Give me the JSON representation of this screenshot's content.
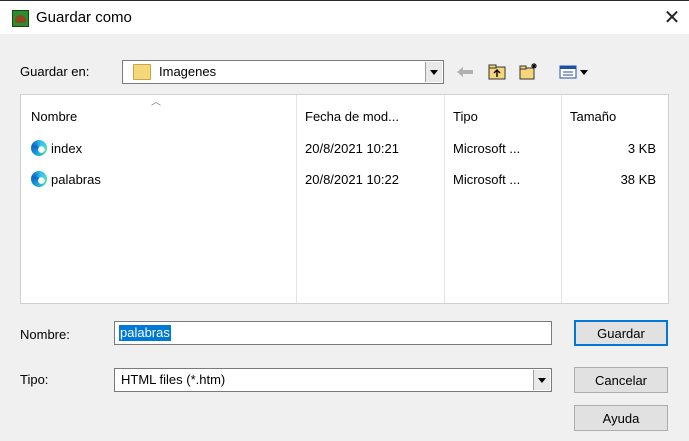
{
  "window": {
    "title": "Guardar como",
    "close": "✕"
  },
  "location": {
    "label": "Guardar en:",
    "folder": "Imagenes"
  },
  "toolbar": {
    "back_icon": "back-arrow-icon",
    "up_icon": "up-folder-icon",
    "new_folder_icon": "new-folder-icon",
    "view_icon": "view-menu-icon"
  },
  "columns": [
    "Nombre",
    "Fecha de mod...",
    "Tipo",
    "Tamaño"
  ],
  "files": [
    {
      "name": "index",
      "date": "20/8/2021 10:21",
      "type": "Microsoft ...",
      "size": "3 KB"
    },
    {
      "name": "palabras",
      "date": "20/8/2021 10:22",
      "type": "Microsoft ...",
      "size": "38 KB"
    }
  ],
  "filename": {
    "label": "Nombre:",
    "value": "palabras"
  },
  "filetype": {
    "label": "Tipo:",
    "value": "HTML files (*.htm)"
  },
  "buttons": {
    "save": "Guardar",
    "cancel": "Cancelar",
    "help": "Ayuda"
  }
}
